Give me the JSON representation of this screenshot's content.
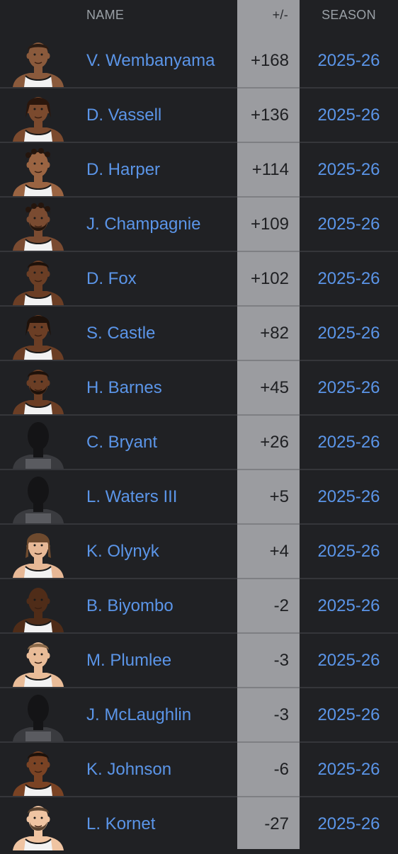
{
  "header": {
    "name": "NAME",
    "plus_minus": "+/-",
    "season": "SEASON"
  },
  "colors": {
    "background": "#202124",
    "plus_minus_column": "#9b9ca0",
    "link_blue": "#5b95e8",
    "header_text": "#9aa0a6"
  },
  "rows": [
    {
      "name": "V. Wembanyama",
      "pm": "+168",
      "season": "2025-26",
      "avatar": {
        "skin": "#8a5a3c",
        "hair": "#2b1b12",
        "style": "short",
        "silhouette": false
      }
    },
    {
      "name": "D. Vassell",
      "pm": "+136",
      "season": "2025-26",
      "avatar": {
        "skin": "#7b4a2e",
        "hair": "#2a160c",
        "style": "locs",
        "silhouette": false
      }
    },
    {
      "name": "D. Harper",
      "pm": "+114",
      "season": "2025-26",
      "avatar": {
        "skin": "#9a6442",
        "hair": "#24150d",
        "style": "curly",
        "silhouette": false
      }
    },
    {
      "name": "J. Champagnie",
      "pm": "+109",
      "season": "2025-26",
      "avatar": {
        "skin": "#7a4b31",
        "hair": "#24150d",
        "style": "curly-beard",
        "silhouette": false
      }
    },
    {
      "name": "D. Fox",
      "pm": "+102",
      "season": "2025-26",
      "avatar": {
        "skin": "#6b3e25",
        "hair": "#1d110a",
        "style": "short",
        "silhouette": false
      }
    },
    {
      "name": "S. Castle",
      "pm": "+82",
      "season": "2025-26",
      "avatar": {
        "skin": "#6b3e25",
        "hair": "#1d110a",
        "style": "locs",
        "silhouette": false
      }
    },
    {
      "name": "H. Barnes",
      "pm": "+45",
      "season": "2025-26",
      "avatar": {
        "skin": "#6b3e25",
        "hair": "#1d110a",
        "style": "short-beard",
        "silhouette": false
      }
    },
    {
      "name": "C. Bryant",
      "pm": "+26",
      "season": "2025-26",
      "avatar": {
        "skin": "#141416",
        "hair": "#141416",
        "style": "silhouette",
        "silhouette": true
      }
    },
    {
      "name": "L. Waters III",
      "pm": "+5",
      "season": "2025-26",
      "avatar": {
        "skin": "#141416",
        "hair": "#141416",
        "style": "silhouette",
        "silhouette": true
      }
    },
    {
      "name": "K. Olynyk",
      "pm": "+4",
      "season": "2025-26",
      "avatar": {
        "skin": "#e7b896",
        "hair": "#6e4a2e",
        "style": "long",
        "silhouette": false
      }
    },
    {
      "name": "B. Biyombo",
      "pm": "-2",
      "season": "2025-26",
      "avatar": {
        "skin": "#4f2c18",
        "hair": "#1a0f09",
        "style": "bald",
        "silhouette": false
      }
    },
    {
      "name": "M. Plumlee",
      "pm": "-3",
      "season": "2025-26",
      "avatar": {
        "skin": "#e9bc98",
        "hair": "#8b6a4a",
        "style": "short",
        "silhouette": false
      }
    },
    {
      "name": "J. McLaughlin",
      "pm": "-3",
      "season": "2025-26",
      "avatar": {
        "skin": "#141416",
        "hair": "#141416",
        "style": "silhouette",
        "silhouette": true
      }
    },
    {
      "name": "K. Johnson",
      "pm": "-6",
      "season": "2025-26",
      "avatar": {
        "skin": "#7a4324",
        "hair": "#1d110a",
        "style": "short",
        "silhouette": false
      }
    },
    {
      "name": "L. Kornet",
      "pm": "-27",
      "season": "2025-26",
      "avatar": {
        "skin": "#efc4a2",
        "hair": "#5a4330",
        "style": "short-beard",
        "silhouette": false
      }
    }
  ]
}
